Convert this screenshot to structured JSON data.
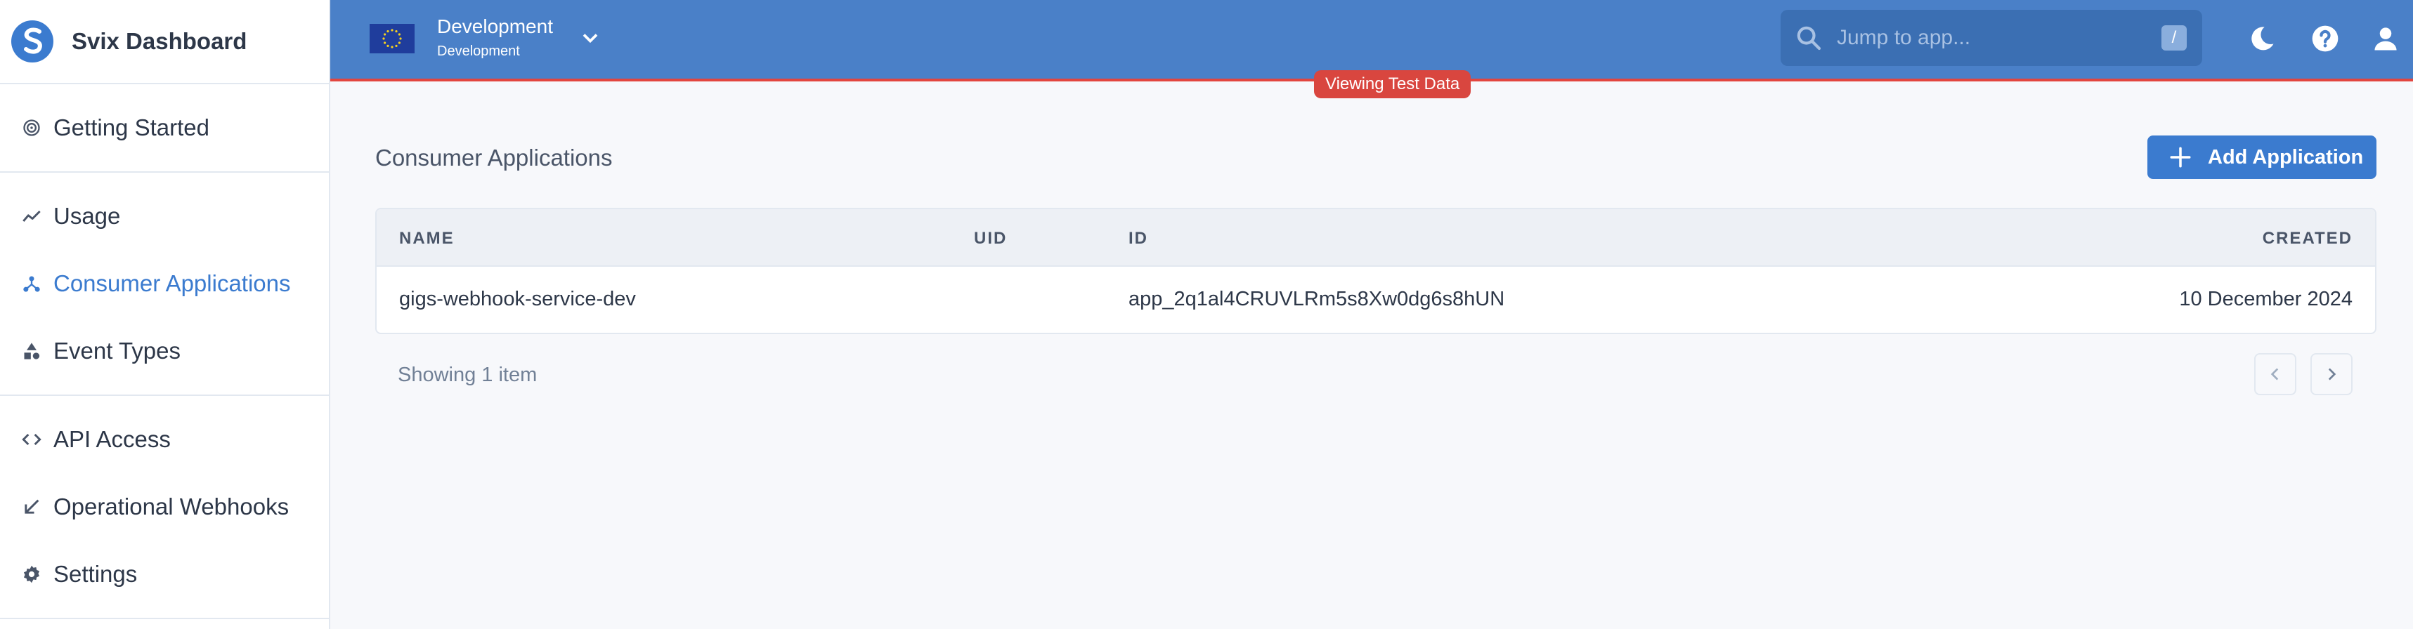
{
  "sidebar": {
    "brand_title": "Svix Dashboard",
    "groups": [
      {
        "items": [
          {
            "label": "Getting Started",
            "icon": "target-icon"
          }
        ]
      },
      {
        "items": [
          {
            "label": "Usage",
            "icon": "trend-icon"
          },
          {
            "label": "Consumer Applications",
            "icon": "apps-icon",
            "active": true
          },
          {
            "label": "Event Types",
            "icon": "shapes-icon"
          }
        ]
      },
      {
        "items": [
          {
            "label": "API Access",
            "icon": "code-icon"
          },
          {
            "label": "Operational Webhooks",
            "icon": "arrow-down-left-icon"
          },
          {
            "label": "Settings",
            "icon": "gear-icon"
          }
        ]
      }
    ]
  },
  "topbar": {
    "environment_name": "Development",
    "environment_sub": "Development",
    "search_placeholder": "Jump to app...",
    "search_shortcut": "/",
    "test_badge": "Viewing Test Data"
  },
  "main": {
    "title": "Consumer Applications",
    "add_button_label": "Add Application",
    "table": {
      "columns": [
        "NAME",
        "UID",
        "ID",
        "CREATED"
      ],
      "rows": [
        {
          "name": "gigs-webhook-service-dev",
          "uid": "",
          "id": "app_2q1al4CRUVLRm5s8Xw0dg6s8hUN",
          "created": "10 December 2024"
        }
      ]
    },
    "footer_text": "Showing 1 item"
  },
  "colors": {
    "accent": "#3b7bcf",
    "topbar": "#4a80c8",
    "test_badge": "#d9463f"
  }
}
